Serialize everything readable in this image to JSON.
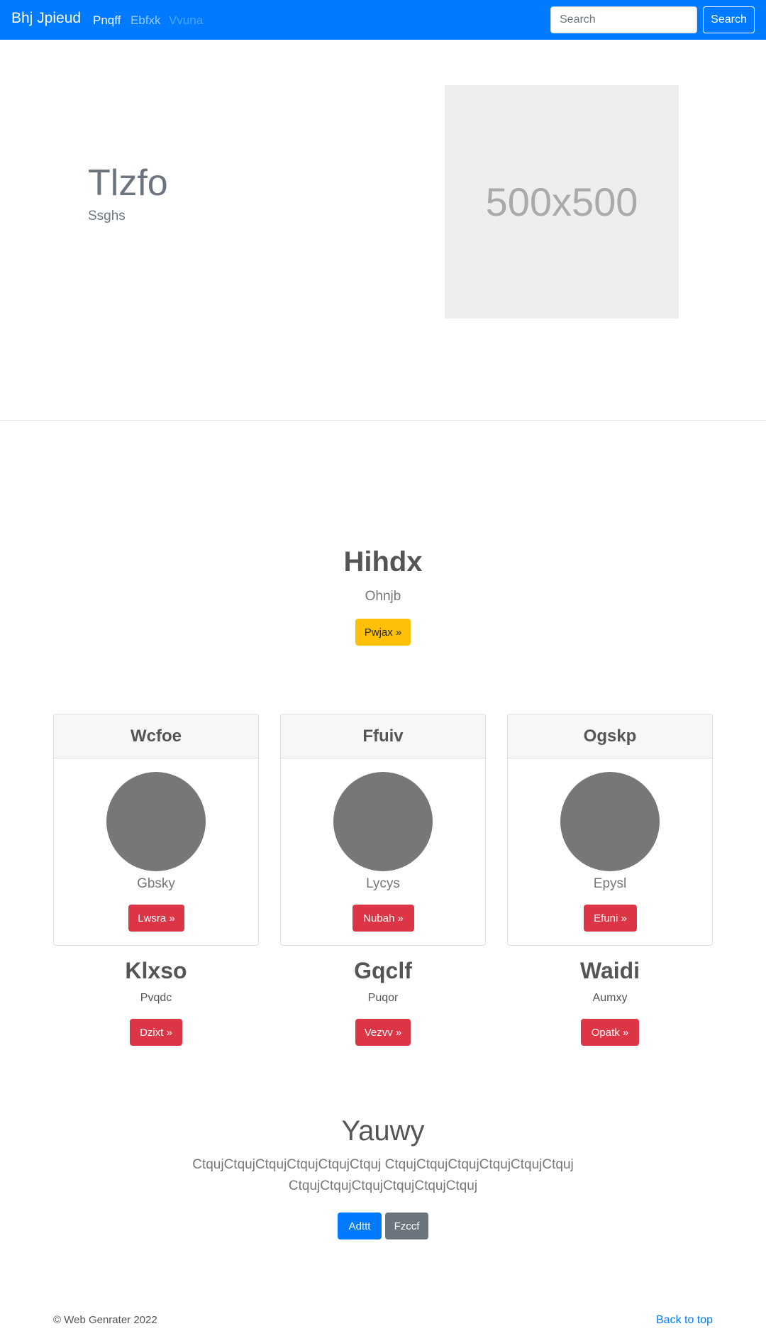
{
  "navbar": {
    "brand": "Bhj Jpieud",
    "links": [
      "Pnqff",
      "Ebfxk",
      "Vvuna"
    ],
    "search_placeholder": "Search",
    "search_button": "Search",
    "color": "#007bff"
  },
  "hero": {
    "title": "Tlzfo",
    "subtitle": "Ssghs",
    "image_label": "500x500"
  },
  "feature": {
    "title": "Hihdx",
    "subtitle": "Ohnjb",
    "button": "Pwjax »"
  },
  "cards": [
    {
      "title": "Wcfoe",
      "text": "Gbsky",
      "button": "Lwsra »"
    },
    {
      "title": "Ffuiv",
      "text": "Lycys",
      "button": "Nubah »"
    },
    {
      "title": "Ogskp",
      "text": "Epysl",
      "button": "Efuni »"
    }
  ],
  "blocks": [
    {
      "title": "Klxso",
      "text": "Pvqdc",
      "button": "Dzixt »"
    },
    {
      "title": "Gqclf",
      "text": "Puqor",
      "button": "Vezvv »"
    },
    {
      "title": "Waidi",
      "text": "Aumxy",
      "button": "Opatk »"
    }
  ],
  "jumbotron": {
    "title": "Yauwy",
    "text": "CtqujCtqujCtqujCtqujCtqujCtquj CtqujCtqujCtqujCtqujCtqujCtquj CtqujCtqujCtqujCtqujCtqujCtquj",
    "primary_button": "Adttt",
    "secondary_button": "Fzccf"
  },
  "footer": {
    "copyright": "© Web Genrater 2022",
    "back_to_top": "Back to top"
  }
}
